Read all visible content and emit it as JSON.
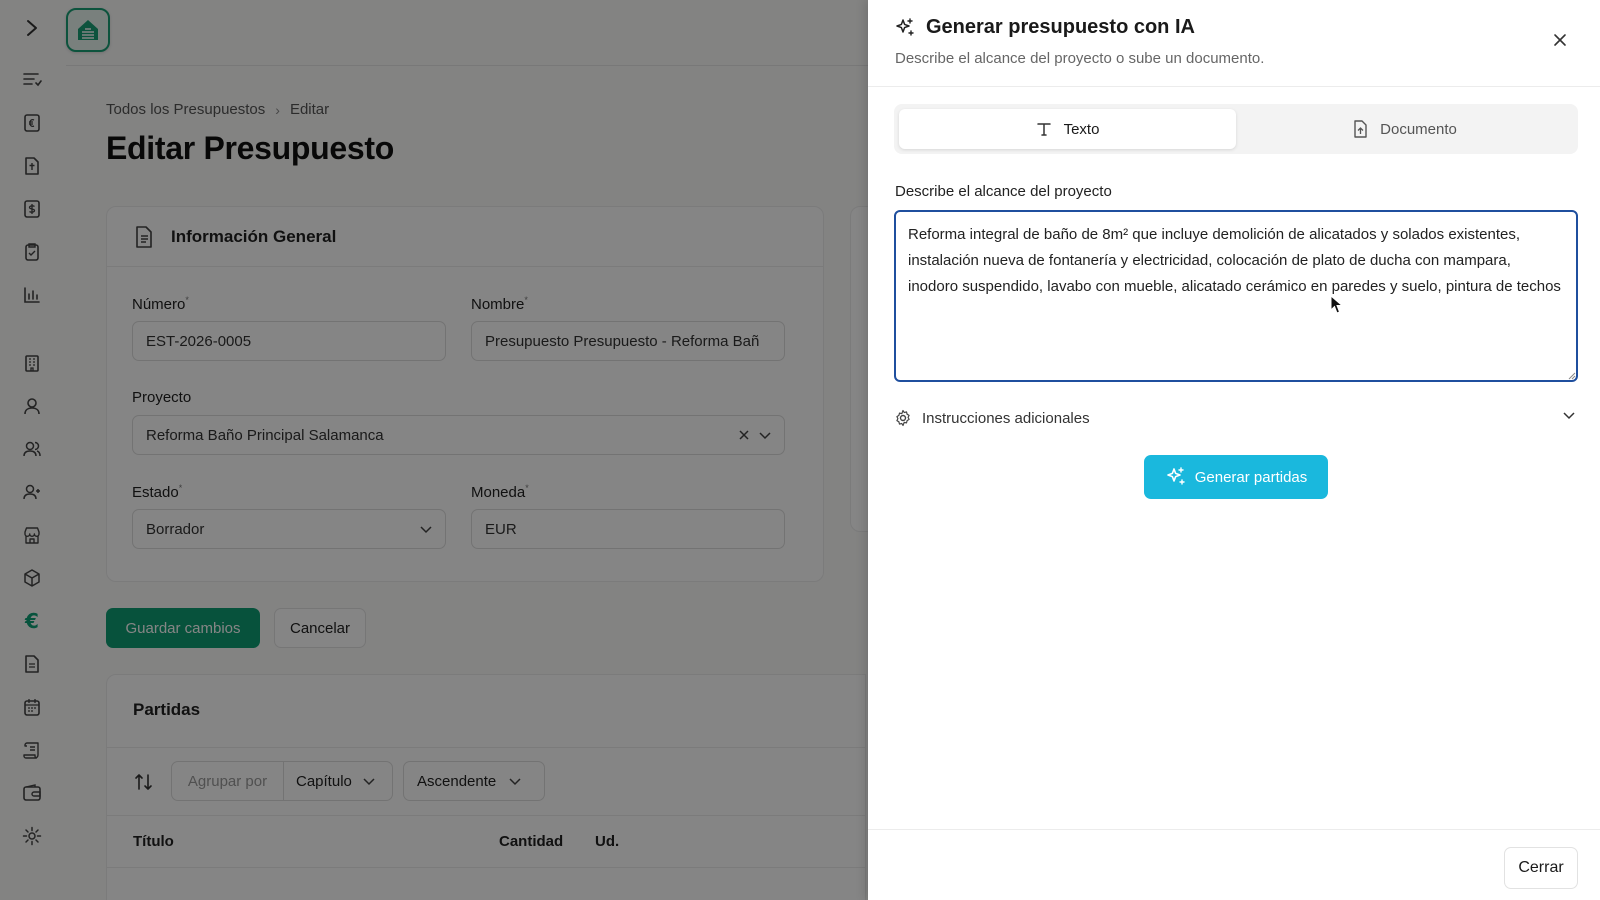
{
  "app": {
    "breadcrumb": {
      "root": "Todos los Presupuestos",
      "current": "Editar"
    },
    "page_title": "Editar Presupuesto",
    "general_card": {
      "title": "Información General",
      "numero_label": "Número",
      "numero_value": "EST-2026-0005",
      "nombre_label": "Nombre",
      "nombre_value": "Presupuesto Presupuesto - Reforma Bañ",
      "proyecto_label": "Proyecto",
      "proyecto_value": "Reforma Baño Principal Salamanca",
      "estado_label": "Estado",
      "estado_value": "Borrador",
      "moneda_label": "Moneda",
      "moneda_value": "EUR"
    },
    "actions": {
      "save": "Guardar cambios",
      "cancel": "Cancelar"
    },
    "partidas": {
      "title": "Partidas",
      "group_by_label": "Agrupar por",
      "group_by_value": "Capítulo",
      "order_value": "Ascendente",
      "columns": {
        "titulo": "Título",
        "cantidad": "Cantidad",
        "ud": "Ud."
      }
    },
    "accent_color": "#0f9d73"
  },
  "panel": {
    "title": "Generar presupuesto con IA",
    "subtitle": "Describe el alcance del proyecto o sube un documento.",
    "tabs": {
      "text": "Texto",
      "document": "Documento"
    },
    "scope_label": "Describe el alcance del proyecto",
    "scope_value": "Reforma integral de baño de 8m² que incluye demolición de alicatados y solados existentes, instalación nueva de fontanería y electricidad, colocación de plato de ducha con mampara, inodoro suspendido, lavabo con mueble, alicatado cerámico en paredes y suelo, pintura de techos",
    "extra_label": "Instrucciones adicionales",
    "generate_button": "Generar partidas",
    "close_button": "Cerrar",
    "generate_color": "#1ab8dd"
  }
}
